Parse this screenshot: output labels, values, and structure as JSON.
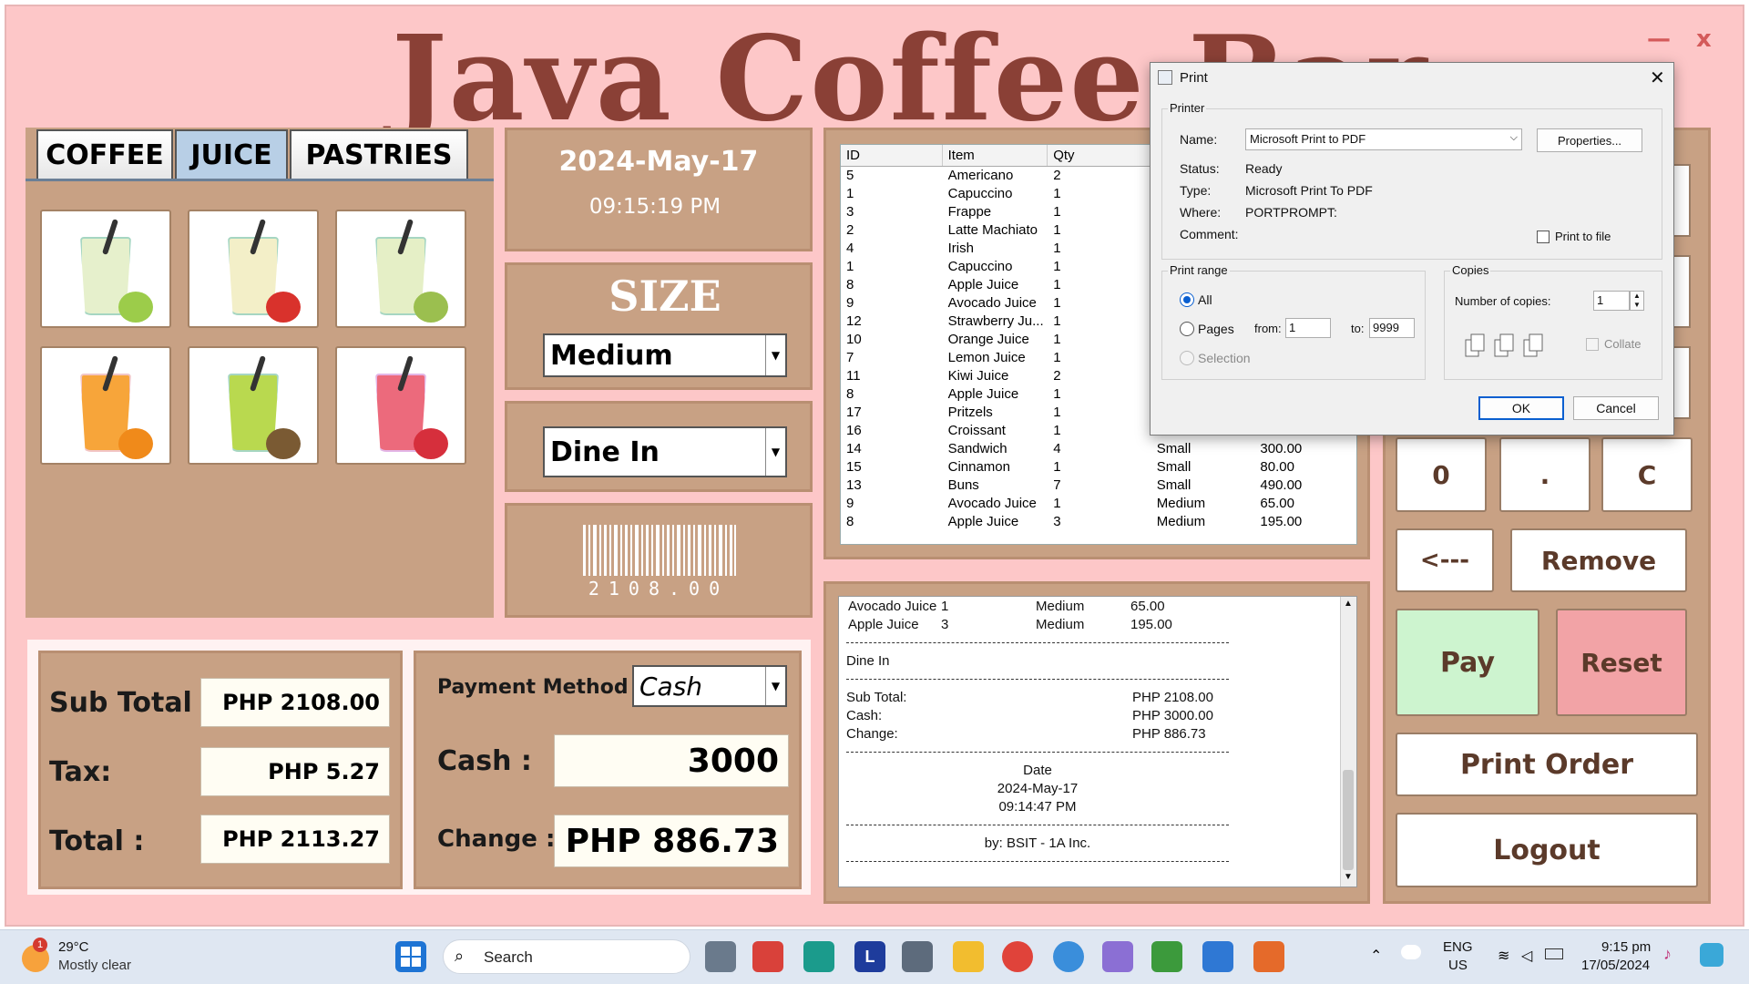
{
  "app": {
    "title": "Java Coffee Bar",
    "minimize": "—",
    "close": "x"
  },
  "tabs": [
    {
      "label": "COFFEE"
    },
    {
      "label": "JUICE"
    },
    {
      "label": "PASTRIES"
    }
  ],
  "products": [
    {
      "name": "lime-juice-icon",
      "color": "#e6f0cc",
      "fruit": "#9ccc4a"
    },
    {
      "name": "apple-juice-icon",
      "color": "#f3efc8",
      "fruit": "#d9322c"
    },
    {
      "name": "pear-juice-icon",
      "color": "#e5efc6",
      "fruit": "#9bbf4f"
    },
    {
      "name": "orange-juice-icon",
      "color": "#f7a53a",
      "fruit": "#f08a1a"
    },
    {
      "name": "kiwi-juice-icon",
      "color": "#b9d94f",
      "fruit": "#7a5a33"
    },
    {
      "name": "strawberry-juice-icon",
      "color": "#ec6a7c",
      "fruit": "#d62f3c"
    }
  ],
  "datetime": {
    "date": "2024-May-17",
    "time": "09:15:19 PM"
  },
  "size": {
    "heading": "SIZE",
    "selected": "Medium"
  },
  "dine": {
    "selected": "Dine In"
  },
  "barcode": {
    "text": "2108.00"
  },
  "totals": {
    "subtotal_label": "Sub Total :",
    "subtotal_value": "PHP 2108.00",
    "tax_label": "Tax:",
    "tax_value": "PHP 5.27",
    "total_label": "Total :",
    "total_value": "PHP 2113.27"
  },
  "payment": {
    "method_label": "Payment Method",
    "method_value": "Cash",
    "cash_label": "Cash :",
    "cash_value": "3000",
    "change_label": "Change :",
    "change_value": "PHP 886.73"
  },
  "order_table": {
    "columns": [
      "ID",
      "Item",
      "Qty",
      "",
      ""
    ],
    "rows": [
      {
        "id": "5",
        "item": "Americano",
        "qty": "2",
        "size": "",
        "price": ""
      },
      {
        "id": "1",
        "item": "Capuccino",
        "qty": "1",
        "size": "",
        "price": ""
      },
      {
        "id": "3",
        "item": "Frappe",
        "qty": "1",
        "size": "",
        "price": ""
      },
      {
        "id": "2",
        "item": "Latte Machiato",
        "qty": "1",
        "size": "",
        "price": ""
      },
      {
        "id": "4",
        "item": "Irish",
        "qty": "1",
        "size": "",
        "price": ""
      },
      {
        "id": "1",
        "item": "Capuccino",
        "qty": "1",
        "size": "",
        "price": ""
      },
      {
        "id": "8",
        "item": "Apple Juice",
        "qty": "1",
        "size": "",
        "price": ""
      },
      {
        "id": "9",
        "item": "Avocado Juice",
        "qty": "1",
        "size": "",
        "price": ""
      },
      {
        "id": "12",
        "item": "Strawberry Ju...",
        "qty": "1",
        "size": "",
        "price": ""
      },
      {
        "id": "10",
        "item": "Orange Juice",
        "qty": "1",
        "size": "",
        "price": ""
      },
      {
        "id": "7",
        "item": "Lemon Juice",
        "qty": "1",
        "size": "",
        "price": ""
      },
      {
        "id": "11",
        "item": "Kiwi Juice",
        "qty": "2",
        "size": "",
        "price": ""
      },
      {
        "id": "8",
        "item": "Apple Juice",
        "qty": "1",
        "size": "",
        "price": ""
      },
      {
        "id": "17",
        "item": "Pritzels",
        "qty": "1",
        "size": "",
        "price": ""
      },
      {
        "id": "16",
        "item": "Croissant",
        "qty": "1",
        "size": "",
        "price": ""
      },
      {
        "id": "14",
        "item": "Sandwich",
        "qty": "4",
        "size": "Small",
        "price": "300.00"
      },
      {
        "id": "15",
        "item": "Cinnamon",
        "qty": "1",
        "size": "Small",
        "price": "80.00"
      },
      {
        "id": "13",
        "item": "Buns",
        "qty": "7",
        "size": "Small",
        "price": "490.00"
      },
      {
        "id": "9",
        "item": "Avocado Juice",
        "qty": "1",
        "size": "Medium",
        "price": "65.00"
      },
      {
        "id": "8",
        "item": "Apple Juice",
        "qty": "3",
        "size": "Medium",
        "price": "195.00"
      }
    ]
  },
  "receipt": {
    "line1": {
      "item": "Avocado Juice",
      "qty": "1",
      "size": "Medium",
      "price": "65.00"
    },
    "line2": {
      "item": "Apple Juice",
      "qty": "3",
      "size": "Medium",
      "price": "195.00"
    },
    "dine": "Dine In",
    "subtotal_label": "Sub Total:",
    "subtotal_value": "PHP 2108.00",
    "cash_label": "Cash:",
    "cash_value": "PHP 3000.00",
    "change_label": "Change:",
    "change_value": "PHP 886.73",
    "date_label": "Date",
    "date_value": "2024-May-17",
    "time_value": "09:14:47 PM",
    "footer": "by: BSIT - 1A Inc."
  },
  "keypad": {
    "zero": "0",
    "dot": ".",
    "clear": "C",
    "back": "<---",
    "remove": "Remove",
    "pay": "Pay",
    "reset": "Reset",
    "print": "Print Order",
    "logout": "Logout"
  },
  "print_dialog": {
    "title": "Print",
    "printer_group": "Printer",
    "name_label": "Name:",
    "name_value": "Microsoft Print to PDF",
    "properties": "Properties...",
    "status_label": "Status:",
    "status_value": "Ready",
    "type_label": "Type:",
    "type_value": "Microsoft Print To PDF",
    "where_label": "Where:",
    "where_value": "PORTPROMPT:",
    "comment_label": "Comment:",
    "print_to_file": "Print to file",
    "range_group": "Print range",
    "all": "All",
    "pages": "Pages",
    "from_label": "from:",
    "from_value": "1",
    "to_label": "to:",
    "to_value": "9999",
    "selection": "Selection",
    "copies_group": "Copies",
    "copies_label": "Number of copies:",
    "copies_value": "1",
    "collate": "Collate",
    "ok": "OK",
    "cancel": "Cancel"
  },
  "taskbar": {
    "temp": "29°C",
    "weather": "Mostly clear",
    "search": "Search",
    "lang1": "ENG",
    "lang2": "US",
    "time": "9:15 pm",
    "date": "17/05/2024",
    "badge": "1"
  }
}
